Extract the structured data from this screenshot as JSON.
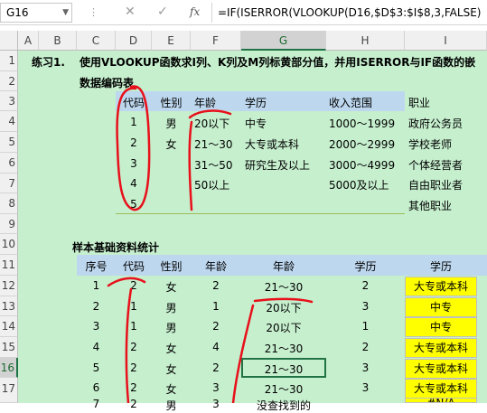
{
  "formula_bar": {
    "name_box": "G16",
    "formula": "=IF(ISERROR(VLOOKUP(D16,$D$3:$I$8,3,FALSE)"
  },
  "columns": [
    "A",
    "B",
    "C",
    "D",
    "E",
    "F",
    "G",
    "H",
    "I"
  ],
  "rows": [
    "1",
    "2",
    "3",
    "4",
    "5",
    "6",
    "7",
    "8",
    "9",
    "10",
    "11",
    "12",
    "13",
    "14",
    "15",
    "16",
    "17"
  ],
  "exercise": {
    "label": "练习1.",
    "instruction": "使用VLOOKUP函数求I列、K列及M列标黄部分值，并用ISERROR与IF函数的嵌",
    "table1_title": "数据编码表",
    "table2_title": "样本基础资料统计"
  },
  "code_table": {
    "headers": [
      "代码",
      "性别",
      "年龄",
      "学历",
      "收入范围",
      "职业"
    ],
    "rows": [
      [
        "1",
        "男",
        "20以下",
        "中专",
        "1000～1999",
        "政府公务员"
      ],
      [
        "2",
        "女",
        "21～30",
        "大专或本科",
        "2000～2999",
        "学校老师"
      ],
      [
        "3",
        "",
        "31～50",
        "研究生及以上",
        "3000～4999",
        "个体经营者"
      ],
      [
        "4",
        "",
        "50以上",
        "",
        "5000及以上",
        "自由职业者"
      ],
      [
        "5",
        "",
        "",
        "",
        "",
        "其他职业"
      ]
    ]
  },
  "sample_table": {
    "headers": [
      "序号",
      "代码",
      "性别",
      "年龄",
      "年龄",
      "学历",
      "学历"
    ],
    "rows": [
      [
        "1",
        "2",
        "女",
        "2",
        "21～30",
        "2",
        "大专或本科"
      ],
      [
        "2",
        "1",
        "男",
        "1",
        "20以下",
        "3",
        "中专"
      ],
      [
        "3",
        "1",
        "男",
        "2",
        "20以下",
        "1",
        "中专"
      ],
      [
        "4",
        "2",
        "女",
        "4",
        "21～30",
        "2",
        "大专或本科"
      ],
      [
        "5",
        "2",
        "女",
        "2",
        "21～30",
        "3",
        "大专或本科"
      ],
      [
        "6",
        "2",
        "女",
        "3",
        "21～30",
        "3",
        "大专或本科"
      ],
      [
        "7",
        "2",
        "男",
        "3",
        "没查找到的",
        "",
        "#N/A"
      ]
    ]
  }
}
